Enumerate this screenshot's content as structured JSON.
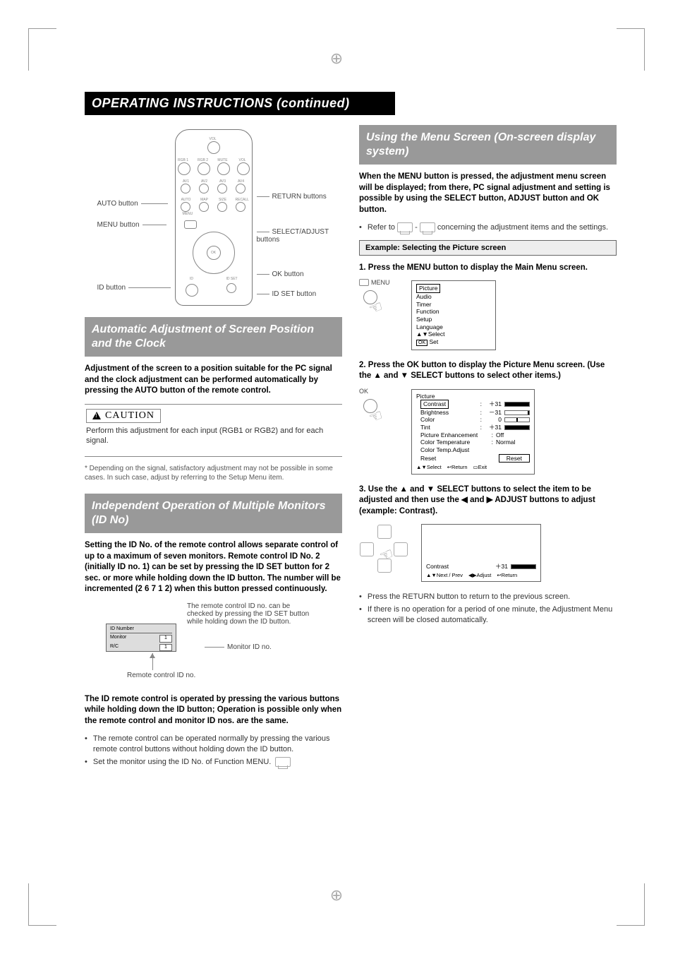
{
  "header": {
    "title": "OPERATING INSTRUCTIONS (continued)"
  },
  "remote_labels": {
    "auto_button": "AUTO button",
    "menu_button": "MENU button",
    "id_button": "ID button",
    "return_buttons": "RETURN buttons",
    "select_adjust_buttons": "SELECT/ADJUST buttons",
    "ok_button": "OK button",
    "id_set_button": "ID SET button",
    "row1": [
      "VOL"
    ],
    "row2": [
      "RGB 1",
      "RGB 2",
      "MUTE",
      "VOL"
    ],
    "row3": [
      "AV1",
      "AV2",
      "AV3",
      "AV4"
    ],
    "row4": [
      "AUTO",
      "MAP",
      "SIZE",
      "RECALL"
    ],
    "menu_small": "MENU",
    "ok_small": "OK",
    "id_small": "ID",
    "idset_small": "ID SET"
  },
  "left": {
    "section_auto": {
      "heading": "Automatic Adjustment of Screen Position and the Clock",
      "intro": "Adjustment of the screen to a position suitable for the PC signal and the clock adjustment can be performed automatically by pressing the AUTO button of the remote control.",
      "caution_label": "CAUTION",
      "caution_body": "Perform this adjustment for each input (RGB1 or RGB2) and for each signal.",
      "asterisk": "* Depending on the signal, satisfactory adjustment may not be possible in some cases. In such case, adjust by referring to the Setup Menu item."
    },
    "section_id": {
      "heading": "Independent Operation of Multiple Monitors (ID No)",
      "intro": "Setting the ID No. of the remote control allows separate control of up to a maximum of seven monitors. Remote control ID No. 2 (initially ID no. 1) can be set by pressing the ID SET button for 2 sec. or more while holding down the ID button.  The number will be incremented (2   6   7   1   2) when this button pressed continuously.",
      "fig_caption_1": "The remote control ID no. can be checked by pressing the ID SET button while holding down the ID button.",
      "fig_caption_2": "Monitor ID no.",
      "fig_caption_3": "Remote control ID no.",
      "idnum_box": {
        "title": "ID Number",
        "monitor_label": "Monitor",
        "monitor_val": "1",
        "rc_label": "R/C",
        "rc_val": "1"
      },
      "intro2": "The ID remote control is operated by pressing the various buttons while holding down the ID button; Operation is possible only when the remote control and monitor ID nos. are the same.",
      "bullet1": "The remote control can be operated normally by pressing the various remote control buttons without holding down the ID button.",
      "bullet2": "Set the monitor using the ID No. of Function MENU."
    }
  },
  "right": {
    "heading": "Using the Menu Screen (On-screen display system)",
    "intro": "When the MENU button is pressed, the adjustment menu screen will be displayed; from there, PC signal adjustment and setting is possible by using the SELECT button, ADJUST button and OK button.",
    "refer_prefix": "Refer to ",
    "refer_mid": " - ",
    "refer_suffix": " concerning the adjustment items and the settings.",
    "example_box": "Example: Selecting the Picture screen",
    "step1": "1. Press the MENU button to display the Main Menu screen.",
    "step1_btn_label": "MENU",
    "main_menu": {
      "items": [
        "Picture",
        "Audio",
        "Timer",
        "Function",
        "Setup",
        "Language"
      ],
      "footer_select": "Select",
      "footer_set_pre": "OK",
      "footer_set": " Set"
    },
    "step2": "2. Press the OK button to display the Picture Menu screen. (Use the ▲ and ▼ SELECT buttons to select other items.)",
    "step2_btn_label": "OK",
    "picture_menu": {
      "title": "Picture",
      "rows": [
        {
          "label": "Contrast",
          "sep": ":",
          "val": "＋31",
          "bar": "full"
        },
        {
          "label": "Brightness",
          "sep": ":",
          "val": "－31",
          "bar": "none"
        },
        {
          "label": "Color",
          "sep": ":",
          "val": "0",
          "bar": "half"
        },
        {
          "label": "Tint",
          "sep": ":",
          "val": "＋31",
          "bar": "full"
        },
        {
          "label": "Picture Enhancement",
          "sep": ":",
          "val": "Off"
        },
        {
          "label": "Color Temperature",
          "sep": ":",
          "val": "Normal"
        },
        {
          "label": "Color Temp.Adjust",
          "sep": "",
          "val": ""
        },
        {
          "label": "Reset",
          "sep": "",
          "val": "Reset",
          "btn": true
        }
      ],
      "footer_select": "Select",
      "footer_return": "Return",
      "footer_exit": "Exit"
    },
    "step3": "3. Use the ▲ and ▼ SELECT buttons to select the item to be adjusted and then use the ◀ and ▶ ADJUST buttons to adjust (example: Contrast).",
    "contrast_osd": {
      "label": "Contrast",
      "val": "＋31",
      "footer_nextprev": "Next / Prev",
      "footer_adjust": "Adjust",
      "footer_return": "Return"
    },
    "tail_b1": "Press the RETURN button to return to the previous screen.",
    "tail_b2": "If there is no operation for a period of one minute, the Adjustment Menu screen will be closed automatically."
  }
}
